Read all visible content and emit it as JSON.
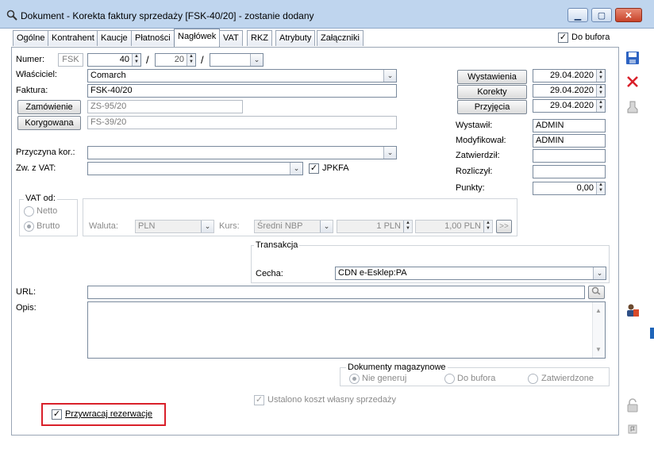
{
  "window": {
    "title": "Dokument - Korekta faktury sprzedaży [FSK-40/20]  - zostanie dodany"
  },
  "tabs": [
    "Ogólne",
    "Kontrahent",
    "Kaucje",
    "Płatności",
    "Nagłówek",
    "VAT",
    "RKZ",
    "Atrybuty",
    "Załączniki"
  ],
  "active_tab": "Nagłówek",
  "do_bufora": {
    "label": "Do bufora",
    "checked": true
  },
  "numer": {
    "label": "Numer:",
    "prefix": "FSK",
    "number": "40",
    "year": "20",
    "series": ""
  },
  "wlasciciel": {
    "label": "Właściciel:",
    "value": "Comarch"
  },
  "faktura": {
    "label": "Faktura:",
    "value": "FSK-40/20"
  },
  "zamowienie": {
    "button": "Zamówienie",
    "value": "ZS-95/20"
  },
  "korygowana": {
    "button": "Korygowana",
    "value": "FS-39/20"
  },
  "przyczyna": {
    "label": "Przyczyna kor.:",
    "value": ""
  },
  "zw_vat": {
    "label": "Zw. z VAT:",
    "value": "",
    "jpkfa_label": "JPKFA",
    "jpkfa_checked": true
  },
  "dates": [
    {
      "button": "Wystawienia",
      "value": "29.04.2020"
    },
    {
      "button": "Korekty",
      "value": "29.04.2020"
    },
    {
      "button": "Przyjęcia",
      "value": "29.04.2020"
    }
  ],
  "people": [
    {
      "label": "Wystawił:",
      "value": "ADMIN"
    },
    {
      "label": "Modyfikował:",
      "value": "ADMIN"
    },
    {
      "label": "Zatwierdził:",
      "value": ""
    },
    {
      "label": "Rozliczył:",
      "value": ""
    }
  ],
  "punkty": {
    "label": "Punkty:",
    "value": "0,00"
  },
  "vat_od": {
    "title": "VAT od:",
    "options": [
      "Netto",
      "Brutto"
    ],
    "selected": "Brutto"
  },
  "waluta": {
    "label": "Waluta:",
    "value": "PLN",
    "kurs_label": "Kurs:",
    "kurs_type": "Średni NBP",
    "kurs_from": "1 PLN",
    "kurs_to": "1,00 PLN",
    "arrow": ">>"
  },
  "transakcja": {
    "title": "Transakcja",
    "cecha_label": "Cecha:",
    "cecha_value": "CDN e-Esklep:PA"
  },
  "url": {
    "label": "URL:",
    "value": ""
  },
  "opis": {
    "label": "Opis:",
    "value": ""
  },
  "dok_mag": {
    "title": "Dokumenty magazynowe",
    "options": [
      "Nie generuj",
      "Do bufora",
      "Zatwierdzone"
    ],
    "selected": "Nie generuj"
  },
  "koszt": {
    "label": "Ustalono koszt własny sprzedaży",
    "checked": true
  },
  "rezerwacje": {
    "label": "Przywracaj rezerwacje",
    "checked": true
  },
  "colors": {
    "highlight": "#d9202a",
    "titlebar": "#bfd5ee"
  }
}
